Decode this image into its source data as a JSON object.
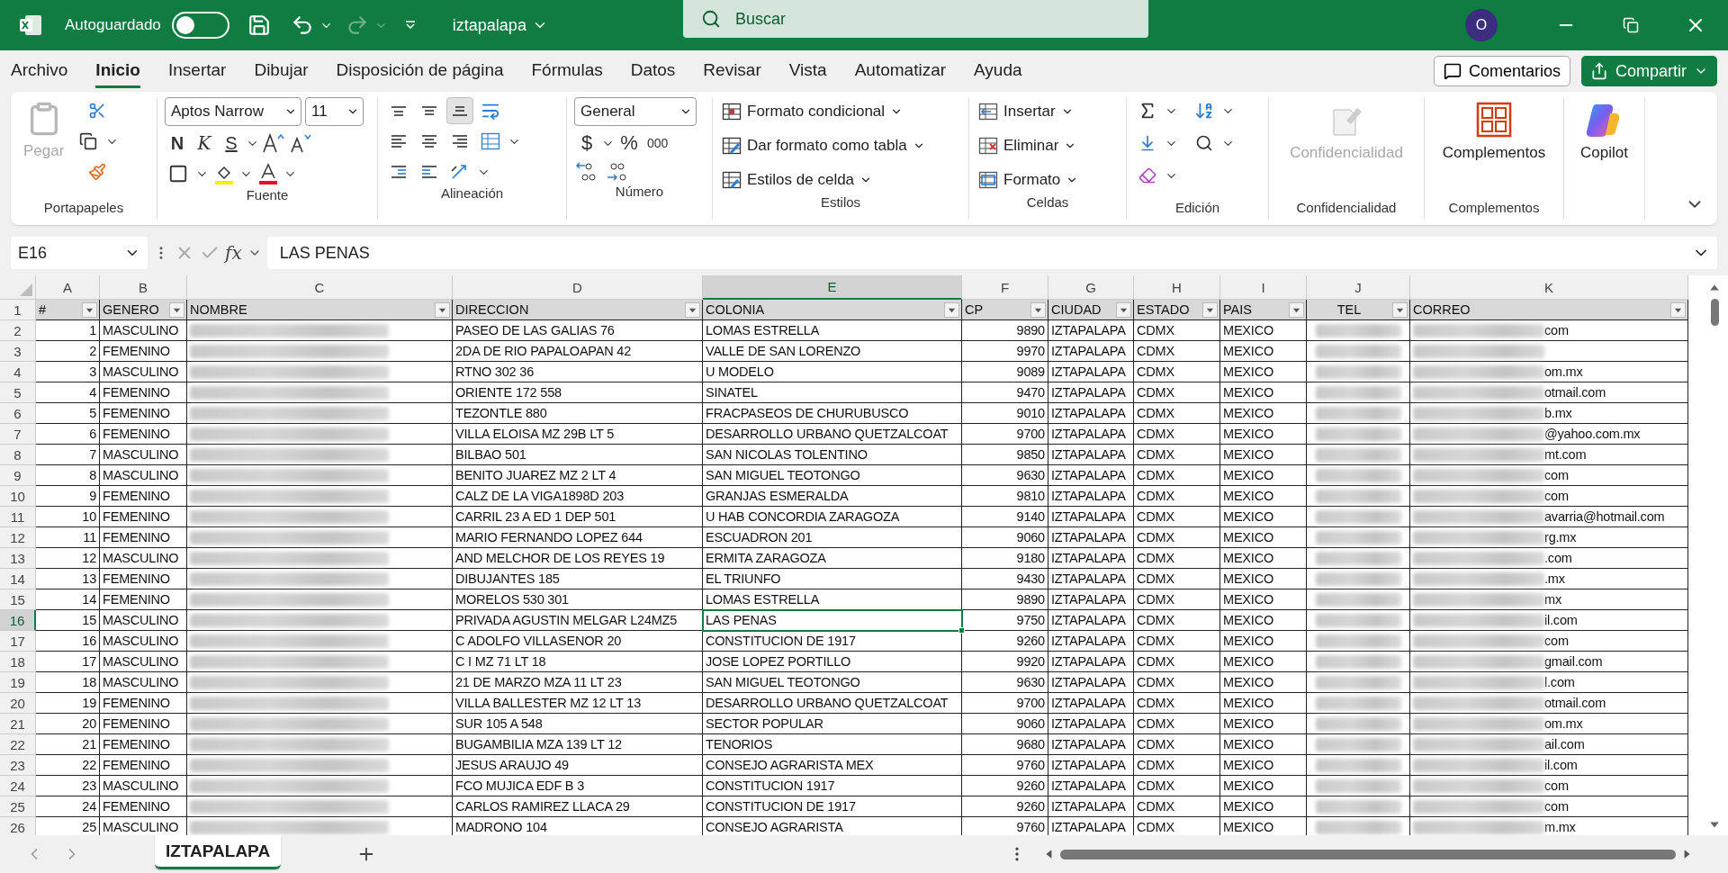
{
  "title_bar": {
    "autosave_label": "Autoguardado",
    "autosave_on": false,
    "file_name": "iztapalapa",
    "search_placeholder": "Buscar",
    "avatar": "O"
  },
  "menu_tabs": [
    {
      "label": "Archivo",
      "selected": false
    },
    {
      "label": "Inicio",
      "selected": true
    },
    {
      "label": "Insertar",
      "selected": false
    },
    {
      "label": "Dibujar",
      "selected": false
    },
    {
      "label": "Disposición de página",
      "selected": false
    },
    {
      "label": "Fórmulas",
      "selected": false
    },
    {
      "label": "Datos",
      "selected": false
    },
    {
      "label": "Revisar",
      "selected": false
    },
    {
      "label": "Vista",
      "selected": false
    },
    {
      "label": "Automatizar",
      "selected": false
    },
    {
      "label": "Ayuda",
      "selected": false
    }
  ],
  "comments_button": "Comentarios",
  "share_button": "Compartir",
  "ribbon": {
    "clipboard": {
      "paste": "Pegar",
      "paste_disabled": true,
      "label": "Portapapeles"
    },
    "font": {
      "name": "Aptos Narrow",
      "size": "11",
      "bold": "N",
      "italic": "K",
      "underline": "S",
      "label": "Fuente"
    },
    "alignment": {
      "vertical": [
        {
          "selected": false
        },
        {
          "selected": false
        },
        {
          "selected": true
        }
      ],
      "label": "Alineación"
    },
    "number": {
      "format": "General",
      "currency": "$",
      "percent": "%",
      "thousands": "000",
      "label": "Número"
    },
    "styles": {
      "items": [
        "Formato condicional",
        "Dar formato como tabla",
        "Estilos de celda"
      ],
      "label": "Estilos"
    },
    "cells": {
      "items": [
        "Insertar",
        "Eliminar",
        "Formato"
      ],
      "label": "Celdas"
    },
    "editing": {
      "label": "Edición"
    },
    "sensitivity": {
      "button": "Confidencialidad",
      "disabled": true,
      "label": "Confidencialidad"
    },
    "addins": {
      "button": "Complementos",
      "label": "Complementos"
    },
    "copilot": {
      "button": "Copilot"
    }
  },
  "formula_bar": {
    "name_box": "E16",
    "function_label": "fx",
    "content": "LAS PENAS"
  },
  "sheet": {
    "columns": [
      {
        "letter": "A",
        "header": "#",
        "kind": "plain",
        "right_aligned": true,
        "centered": false,
        "filter": true,
        "selected": false
      },
      {
        "letter": "B",
        "header": "GENERO",
        "kind": "plain",
        "right_aligned": false,
        "centered": false,
        "filter": true,
        "selected": false
      },
      {
        "letter": "C",
        "header": "NOMBRE",
        "kind": "blurred",
        "right_aligned": false,
        "centered": false,
        "filter": true,
        "selected": false
      },
      {
        "letter": "D",
        "header": "DIRECCION",
        "kind": "plain",
        "right_aligned": false,
        "centered": false,
        "filter": true,
        "selected": false
      },
      {
        "letter": "E",
        "header": "COLONIA",
        "kind": "plain",
        "right_aligned": false,
        "centered": false,
        "filter": true,
        "selected": true
      },
      {
        "letter": "F",
        "header": "CP",
        "kind": "plain",
        "right_aligned": true,
        "centered": false,
        "filter": true,
        "selected": false
      },
      {
        "letter": "G",
        "header": "CIUDAD",
        "kind": "plain",
        "right_aligned": false,
        "centered": false,
        "filter": true,
        "selected": false
      },
      {
        "letter": "H",
        "header": "ESTADO",
        "kind": "plain",
        "right_aligned": false,
        "centered": false,
        "filter": true,
        "selected": false
      },
      {
        "letter": "I",
        "header": "PAIS",
        "kind": "plain",
        "right_aligned": false,
        "centered": false,
        "filter": true,
        "selected": false
      },
      {
        "letter": "J",
        "header": "TEL",
        "kind": "blurred",
        "right_aligned": false,
        "centered": true,
        "filter": true,
        "selected": false
      },
      {
        "letter": "K",
        "header": "CORREO",
        "kind": "masked",
        "right_aligned": false,
        "centered": false,
        "filter": true,
        "selected": false
      }
    ],
    "header_row": "1",
    "rows": [
      {
        "n": "2",
        "selected": false,
        "cells": {
          "A": "1",
          "B": "MASCULINO",
          "D": "PASEO DE LAS GALIAS 76",
          "E": "LOMAS ESTRELLA",
          "F": "9890",
          "G": "IZTAPALAPA",
          "H": "CDMX",
          "I": "MEXICO",
          "K": "com"
        }
      },
      {
        "n": "3",
        "selected": false,
        "cells": {
          "A": "2",
          "B": "FEMENINO",
          "D": "2DA DE RIO PAPALOAPAN 42",
          "E": "VALLE DE SAN LORENZO",
          "F": "9970",
          "G": "IZTAPALAPA",
          "H": "CDMX",
          "I": "MEXICO"
        }
      },
      {
        "n": "4",
        "selected": false,
        "cells": {
          "A": "3",
          "B": "MASCULINO",
          "D": "RTNO 302 36",
          "E": "U MODELO",
          "F": "9089",
          "G": "IZTAPALAPA",
          "H": "CDMX",
          "I": "MEXICO",
          "K": "om.mx"
        }
      },
      {
        "n": "5",
        "selected": false,
        "cells": {
          "A": "4",
          "B": "FEMENINO",
          "D": "ORIENTE 172 558",
          "E": "SINATEL",
          "F": "9470",
          "G": "IZTAPALAPA",
          "H": "CDMX",
          "I": "MEXICO",
          "K": "otmail.com"
        }
      },
      {
        "n": "6",
        "selected": false,
        "cells": {
          "A": "5",
          "B": "FEMENINO",
          "D": "TEZONTLE 880",
          "E": "FRACPASEOS DE CHURUBUSCO",
          "F": "9010",
          "G": "IZTAPALAPA",
          "H": "CDMX",
          "I": "MEXICO",
          "K": "b.mx"
        }
      },
      {
        "n": "7",
        "selected": false,
        "cells": {
          "A": "6",
          "B": "FEMENINO",
          "D": "VILLA ELOISA MZ 29B LT 5",
          "E": "DESARROLLO URBANO QUETZALCOAT",
          "F": "9700",
          "G": "IZTAPALAPA",
          "H": "CDMX",
          "I": "MEXICO",
          "K": "@yahoo.com.mx"
        }
      },
      {
        "n": "8",
        "selected": false,
        "cells": {
          "A": "7",
          "B": "MASCULINO",
          "D": "BILBAO 501",
          "E": "SAN NICOLAS TOLENTINO",
          "F": "9850",
          "G": "IZTAPALAPA",
          "H": "CDMX",
          "I": "MEXICO",
          "K": "mt.com"
        }
      },
      {
        "n": "9",
        "selected": false,
        "cells": {
          "A": "8",
          "B": "MASCULINO",
          "D": "BENITO JUAREZ MZ 2 LT 4",
          "E": "SAN MIGUEL TEOTONGO",
          "F": "9630",
          "G": "IZTAPALAPA",
          "H": "CDMX",
          "I": "MEXICO",
          "K": "com"
        }
      },
      {
        "n": "10",
        "selected": false,
        "cells": {
          "A": "9",
          "B": "FEMENINO",
          "D": "CALZ DE LA VIGA1898D 203",
          "E": "GRANJAS ESMERALDA",
          "F": "9810",
          "G": "IZTAPALAPA",
          "H": "CDMX",
          "I": "MEXICO",
          "K": "com"
        }
      },
      {
        "n": "11",
        "selected": false,
        "cells": {
          "A": "10",
          "B": "FEMENINO",
          "D": "CARRIL 23 A ED 1 DEP 501",
          "E": "U HAB CONCORDIA ZARAGOZA",
          "F": "9140",
          "G": "IZTAPALAPA",
          "H": "CDMX",
          "I": "MEXICO",
          "K": "avarria@hotmail.com"
        }
      },
      {
        "n": "12",
        "selected": false,
        "cells": {
          "A": "11",
          "B": "FEMENINO",
          "D": "MARIO FERNANDO LOPEZ 644",
          "E": "ESCUADRON 201",
          "F": "9060",
          "G": "IZTAPALAPA",
          "H": "CDMX",
          "I": "MEXICO",
          "K": "rg.mx"
        }
      },
      {
        "n": "13",
        "selected": false,
        "cells": {
          "A": "12",
          "B": "MASCULINO",
          "D": "AND MELCHOR DE LOS REYES 19",
          "E": "ERMITA ZARAGOZA",
          "F": "9180",
          "G": "IZTAPALAPA",
          "H": "CDMX",
          "I": "MEXICO",
          "K": ".com"
        }
      },
      {
        "n": "14",
        "selected": false,
        "cells": {
          "A": "13",
          "B": "FEMENINO",
          "D": "DIBUJANTES 185",
          "E": "EL TRIUNFO",
          "F": "9430",
          "G": "IZTAPALAPA",
          "H": "CDMX",
          "I": "MEXICO",
          "K": ".mx"
        }
      },
      {
        "n": "15",
        "selected": false,
        "cells": {
          "A": "14",
          "B": "FEMENINO",
          "D": "MORELOS 530 301",
          "E": "LOMAS ESTRELLA",
          "F": "9890",
          "G": "IZTAPALAPA",
          "H": "CDMX",
          "I": "MEXICO",
          "K": "mx"
        }
      },
      {
        "n": "16",
        "selected": true,
        "cells": {
          "A": "15",
          "B": "MASCULINO",
          "D": "PRIVADA AGUSTIN MELGAR L24MZ5",
          "E": "LAS PENAS",
          "F": "9750",
          "G": "IZTAPALAPA",
          "H": "CDMX",
          "I": "MEXICO",
          "K": "il.com"
        }
      },
      {
        "n": "17",
        "selected": false,
        "cells": {
          "A": "16",
          "B": "MASCULINO",
          "D": "C ADOLFO VILLASENOR 20",
          "E": "CONSTITUCION DE 1917",
          "F": "9260",
          "G": "IZTAPALAPA",
          "H": "CDMX",
          "I": "MEXICO",
          "K": "com"
        }
      },
      {
        "n": "18",
        "selected": false,
        "cells": {
          "A": "17",
          "B": "MASCULINO",
          "D": "C I MZ 71 LT 18",
          "E": "JOSE LOPEZ PORTILLO",
          "F": "9920",
          "G": "IZTAPALAPA",
          "H": "CDMX",
          "I": "MEXICO",
          "K": "gmail.com"
        }
      },
      {
        "n": "19",
        "selected": false,
        "cells": {
          "A": "18",
          "B": "MASCULINO",
          "D": "21 DE MARZO MZA 11 LT 23",
          "E": "SAN MIGUEL TEOTONGO",
          "F": "9630",
          "G": "IZTAPALAPA",
          "H": "CDMX",
          "I": "MEXICO",
          "K": "l.com"
        }
      },
      {
        "n": "20",
        "selected": false,
        "cells": {
          "A": "19",
          "B": "FEMENINO",
          "D": "VILLA BALLESTER MZ 12 LT 13",
          "E": "DESARROLLO URBANO QUETZALCOAT",
          "F": "9700",
          "G": "IZTAPALAPA",
          "H": "CDMX",
          "I": "MEXICO",
          "K": "otmail.com"
        }
      },
      {
        "n": "21",
        "selected": false,
        "cells": {
          "A": "20",
          "B": "FEMENINO",
          "D": "SUR 105 A 548",
          "E": "SECTOR POPULAR",
          "F": "9060",
          "G": "IZTAPALAPA",
          "H": "CDMX",
          "I": "MEXICO",
          "K": "om.mx"
        }
      },
      {
        "n": "22",
        "selected": false,
        "cells": {
          "A": "21",
          "B": "FEMENINO",
          "D": "BUGAMBILIA MZA 139 LT 12",
          "E": "TENORIOS",
          "F": "9680",
          "G": "IZTAPALAPA",
          "H": "CDMX",
          "I": "MEXICO",
          "K": "ail.com"
        }
      },
      {
        "n": "23",
        "selected": false,
        "cells": {
          "A": "22",
          "B": "FEMENINO",
          "D": "JESUS ARAUJO 49",
          "E": "CONSEJO AGRARISTA MEX",
          "F": "9760",
          "G": "IZTAPALAPA",
          "H": "CDMX",
          "I": "MEXICO",
          "K": "il.com"
        }
      },
      {
        "n": "24",
        "selected": false,
        "cells": {
          "A": "23",
          "B": "MASCULINO",
          "D": "FCO MUJICA EDF B 3",
          "E": "CONSTITUCION 1917",
          "F": "9260",
          "G": "IZTAPALAPA",
          "H": "CDMX",
          "I": "MEXICO",
          "K": "com"
        }
      },
      {
        "n": "25",
        "selected": false,
        "cells": {
          "A": "24",
          "B": "FEMENINO",
          "D": "CARLOS RAMIREZ LLACA 29",
          "E": "CONSTITUCION DE 1917",
          "F": "9260",
          "G": "IZTAPALAPA",
          "H": "CDMX",
          "I": "MEXICO",
          "K": "com"
        }
      },
      {
        "n": "26",
        "selected": false,
        "cells": {
          "A": "25",
          "B": "MASCULINO",
          "D": "MADRONO 104",
          "E": "CONSEJO AGRARISTA",
          "F": "9760",
          "G": "IZTAPALAPA",
          "H": "CDMX",
          "I": "MEXICO",
          "K": "m.mx"
        }
      }
    ]
  },
  "sheet_tabs": [
    {
      "label": "IZTAPALAPA",
      "selected": true
    }
  ]
}
